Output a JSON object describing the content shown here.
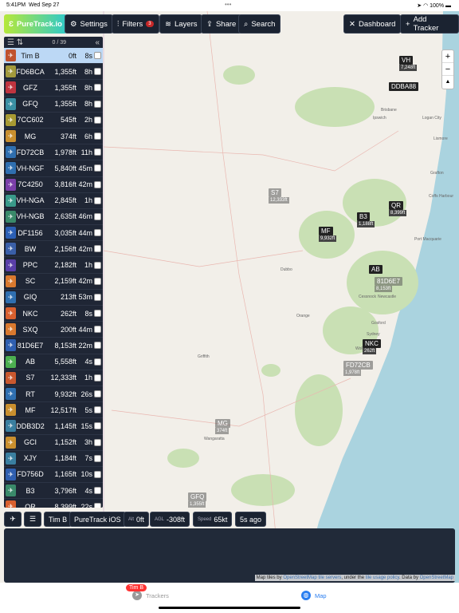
{
  "status": {
    "time": "5:41PM",
    "date": "Wed Sep 27",
    "battery": "100%"
  },
  "toolbar": {
    "logo": "PureTrack.io",
    "settings": "Settings",
    "filters": "Filters",
    "filters_badge": "3",
    "layers": "Layers",
    "share": "Share",
    "search": "Search",
    "dashboard": "Dashboard",
    "add_tracker": "Add Tracker"
  },
  "map_controls": {
    "zoom_in": "+",
    "zoom_out": "−",
    "compass": "▲"
  },
  "sidebar": {
    "count": "0 / 39",
    "trackers": [
      {
        "name": "Tim B",
        "alt": "0ft",
        "age": "8s",
        "color": "#c0532e"
      },
      {
        "name": "FD6BCA",
        "alt": "1,355ft",
        "age": "8h",
        "color": "#a39a3c"
      },
      {
        "name": "GFZ",
        "alt": "1,355ft",
        "age": "8h",
        "color": "#c0343f"
      },
      {
        "name": "GFQ",
        "alt": "1,355ft",
        "age": "8h",
        "color": "#3a8fa3"
      },
      {
        "name": "7CC602",
        "alt": "545ft",
        "age": "2h",
        "color": "#a89a32"
      },
      {
        "name": "MG",
        "alt": "374ft",
        "age": "6h",
        "color": "#c98f2e"
      },
      {
        "name": "FD72CB",
        "alt": "1,978ft",
        "age": "11h",
        "color": "#2f6fb0"
      },
      {
        "name": "VH-NGF",
        "alt": "5,840ft",
        "age": "45m",
        "color": "#2f6fb0"
      },
      {
        "name": "7C4250",
        "alt": "3,816ft",
        "age": "42m",
        "color": "#7b3fa8"
      },
      {
        "name": "VH-NGA",
        "alt": "2,845ft",
        "age": "1h",
        "color": "#3a9a8a"
      },
      {
        "name": "VH-NGB",
        "alt": "2,635ft",
        "age": "46m",
        "color": "#3a8a6a"
      },
      {
        "name": "DF1156",
        "alt": "3,035ft",
        "age": "44m",
        "color": "#2b5fb5"
      },
      {
        "name": "BW",
        "alt": "2,156ft",
        "age": "42m",
        "color": "#3a5fa8"
      },
      {
        "name": "PPC",
        "alt": "2,182ft",
        "age": "1h",
        "color": "#5a3fa8"
      },
      {
        "name": "SC",
        "alt": "2,159ft",
        "age": "42m",
        "color": "#d9792e"
      },
      {
        "name": "GIQ",
        "alt": "213ft",
        "age": "53m",
        "color": "#2f6fb0"
      },
      {
        "name": "NKC",
        "alt": "262ft",
        "age": "8s",
        "color": "#d9602e"
      },
      {
        "name": "SXQ",
        "alt": "200ft",
        "age": "44m",
        "color": "#d9792e"
      },
      {
        "name": "81D6E7",
        "alt": "8,153ft",
        "age": "22m",
        "color": "#2f5fb0"
      },
      {
        "name": "AB",
        "alt": "5,558ft",
        "age": "4s",
        "color": "#4caf50"
      },
      {
        "name": "S7",
        "alt": "12,333ft",
        "age": "1h",
        "color": "#c9582e"
      },
      {
        "name": "RT",
        "alt": "9,932ft",
        "age": "26s",
        "color": "#2f6fb0"
      },
      {
        "name": "MF",
        "alt": "12,517ft",
        "age": "5s",
        "color": "#c98f2e"
      },
      {
        "name": "DDB3D2",
        "alt": "1,145ft",
        "age": "15s",
        "color": "#3a7fa0"
      },
      {
        "name": "GCI",
        "alt": "1,152ft",
        "age": "3h",
        "color": "#c98f2e"
      },
      {
        "name": "XJY",
        "alt": "1,184ft",
        "age": "7s",
        "color": "#3a7fa0"
      },
      {
        "name": "FD756D",
        "alt": "1,165ft",
        "age": "10s",
        "color": "#2f5fb0"
      },
      {
        "name": "B3",
        "alt": "3,796ft",
        "age": "4s",
        "color": "#3a8a6a"
      },
      {
        "name": "QR",
        "alt": "8,399ft",
        "age": "22s",
        "color": "#d9602e"
      }
    ]
  },
  "map": {
    "markers": [
      {
        "name": "VH",
        "alt": "7,248ft"
      },
      {
        "name": "DDBA88",
        "alt": ""
      },
      {
        "name": "S7",
        "alt": "12,333ft"
      },
      {
        "name": "QR",
        "alt": "8,399ft"
      },
      {
        "name": "B3",
        "alt": "1,188ft"
      },
      {
        "name": "MF",
        "alt": "9,932ft"
      },
      {
        "name": "AB",
        "alt": "5,558ft"
      },
      {
        "name": "81D6E7",
        "alt": "8,153ft"
      },
      {
        "name": "NKC",
        "alt": "262ft"
      },
      {
        "name": "FD72CB",
        "alt": "1,978ft"
      },
      {
        "name": "MG",
        "alt": "374ft"
      },
      {
        "name": "GFQ",
        "alt": "1,355ft"
      }
    ],
    "places": [
      "Brisbane",
      "Ipswich",
      "Logan City",
      "Lismore",
      "Grafton",
      "Coffs Harbour",
      "Port Macquarie",
      "Dubbo",
      "Orange",
      "Cessnock",
      "Newcastle",
      "Gosford",
      "Sydney",
      "Wollongong",
      "Griffith",
      "Wangaratta"
    ]
  },
  "info": {
    "name": "Tim B",
    "source": "PureTrack iOS",
    "alt_label": "Alt",
    "alt": "0ft",
    "agl_label": "AGL",
    "agl": "-308ft",
    "speed_label": "Speed",
    "speed": "65kt",
    "ago": "5s ago"
  },
  "attribution": {
    "pre": "Map tiles by ",
    "l1": "OpenStreetMap tile servers",
    "mid": ", under the ",
    "l2": "tile usage policy",
    "mid2": ". Data by ",
    "l3": "OpenStreetMap"
  },
  "tabs": {
    "trackers": "Trackers",
    "trackers_badge": "Tim B",
    "map": "Map"
  }
}
